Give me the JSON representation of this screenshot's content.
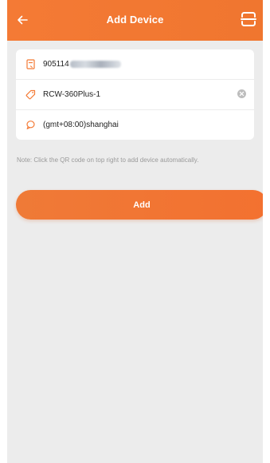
{
  "header": {
    "title": "Add Device",
    "back_icon": "arrow-left-icon",
    "scan_icon": "qr-scan-icon"
  },
  "form": {
    "serial": {
      "visible_value": "905114",
      "icon": "device-id-icon",
      "tail_redacted": true
    },
    "model": {
      "value": "RCW-360Plus-1",
      "icon": "tag-icon",
      "clear_icon": "clear-icon"
    },
    "timezone": {
      "value": "(gmt+08:00)shanghai",
      "icon": "globe-icon"
    }
  },
  "note": "Note: Click the QR code on top right to add device automatically.",
  "actions": {
    "add_label": "Add"
  },
  "colors": {
    "accent": "#f47a35",
    "background": "#ececec",
    "card": "#ffffff",
    "note_text": "#9a9a9a"
  }
}
